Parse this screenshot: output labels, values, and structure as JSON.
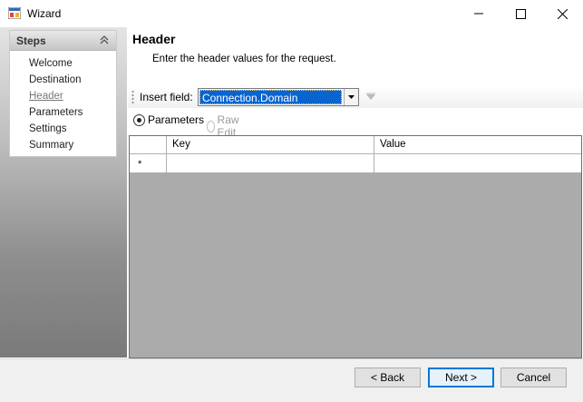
{
  "window": {
    "title": "Wizard",
    "icon": "wizard-app-icon"
  },
  "steps": {
    "title": "Steps",
    "items": [
      {
        "label": "Welcome",
        "current": false
      },
      {
        "label": "Destination",
        "current": false
      },
      {
        "label": "Header",
        "current": true
      },
      {
        "label": "Parameters",
        "current": false
      },
      {
        "label": "Settings",
        "current": false
      },
      {
        "label": "Summary",
        "current": false
      }
    ]
  },
  "page": {
    "title": "Header",
    "description": "Enter the header values for the request."
  },
  "insert_field": {
    "label": "Insert field:",
    "value": "Connection.Domain"
  },
  "mode": {
    "options": [
      {
        "label": "Parameters",
        "selected": true,
        "enabled": true
      },
      {
        "label": "Raw Edit",
        "selected": false,
        "enabled": false
      }
    ]
  },
  "grid": {
    "columns": [
      "Key",
      "Value"
    ],
    "new_row_marker": "*",
    "rows": []
  },
  "footer": {
    "back_label": "< Back",
    "next_label": "Next >",
    "cancel_label": "Cancel"
  },
  "colors": {
    "selection": "#0a64d0",
    "default_button_border": "#0078d7",
    "grid_background": "#ababab"
  }
}
